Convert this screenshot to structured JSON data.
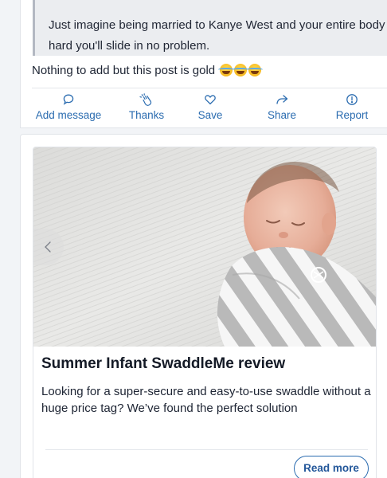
{
  "quote": {
    "line1": "Just imagine being married to Kanye West and your entire body will be so",
    "line2": "hard you'll slide in no problem."
  },
  "post": {
    "text": "Nothing to add but this post is gold",
    "emoji_icon": "face-with-tears-of-joy-icon",
    "emoji_count": 3
  },
  "actions": [
    {
      "label": "Add message",
      "icon": "speech-bubble-icon"
    },
    {
      "label": "Thanks",
      "icon": "clapping-hands-icon"
    },
    {
      "label": "Save",
      "icon": "heart-icon"
    },
    {
      "label": "Share",
      "icon": "share-arrow-icon"
    },
    {
      "label": "Report",
      "icon": "alert-circle-icon"
    }
  ],
  "article": {
    "image_alt": "Sleeping newborn wrapped in grey and white striped swaddle",
    "prev_icon": "chevron-left-icon",
    "title": "Summer Infant SwaddleMe review",
    "description": "Looking for a super-secure and easy-to-use swaddle without a huge price tag? We’ve found the perfect solution",
    "read_more": "Read more"
  },
  "colors": {
    "accent": "#2b6cb0",
    "page_bg": "#f2f4f7",
    "quote_bg": "#ebedf0"
  }
}
